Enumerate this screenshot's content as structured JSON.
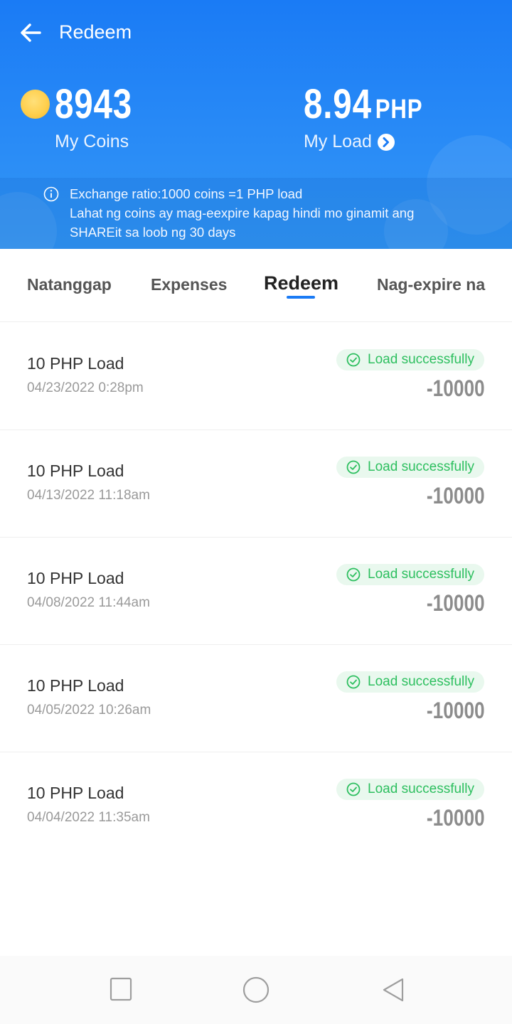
{
  "header": {
    "title": "Redeem",
    "coins_value": "8943",
    "coins_label": "My Coins",
    "load_value": "8.94",
    "load_unit": "PHP",
    "load_label": "My Load",
    "info_line1": "Exchange ratio:1000 coins =1 PHP load",
    "info_line2": "Lahat ng coins ay mag-eexpire kapag hindi mo ginamit ang",
    "info_line3": "SHAREit sa loob ng 30 days"
  },
  "tabs": [
    {
      "label": "Natanggap"
    },
    {
      "label": "Expenses"
    },
    {
      "label": "Redeem",
      "active": true
    },
    {
      "label": "Nag-expire na"
    }
  ],
  "transactions": [
    {
      "title": "10 PHP Load",
      "date": "04/23/2022 0:28pm",
      "status": "Load successfully",
      "amount": "-10000"
    },
    {
      "title": "10 PHP Load",
      "date": "04/13/2022 11:18am",
      "status": "Load successfully",
      "amount": "-10000"
    },
    {
      "title": "10 PHP Load",
      "date": "04/08/2022 11:44am",
      "status": "Load successfully",
      "amount": "-10000"
    },
    {
      "title": "10 PHP Load",
      "date": "04/05/2022 10:26am",
      "status": "Load successfully",
      "amount": "-10000"
    },
    {
      "title": "10 PHP Load",
      "date": "04/04/2022 11:35am",
      "status": "Load successfully",
      "amount": "-10000"
    }
  ],
  "colors": {
    "header_blue": "#1a7bf5",
    "success_green": "#2dbf5f",
    "amount_gray": "#8c8c8c"
  },
  "icons": [
    "back-arrow-icon",
    "coin-icon",
    "chevron-right-circle-icon",
    "info-icon",
    "check-circle-icon",
    "square-icon",
    "circle-icon",
    "triangle-back-icon"
  ]
}
